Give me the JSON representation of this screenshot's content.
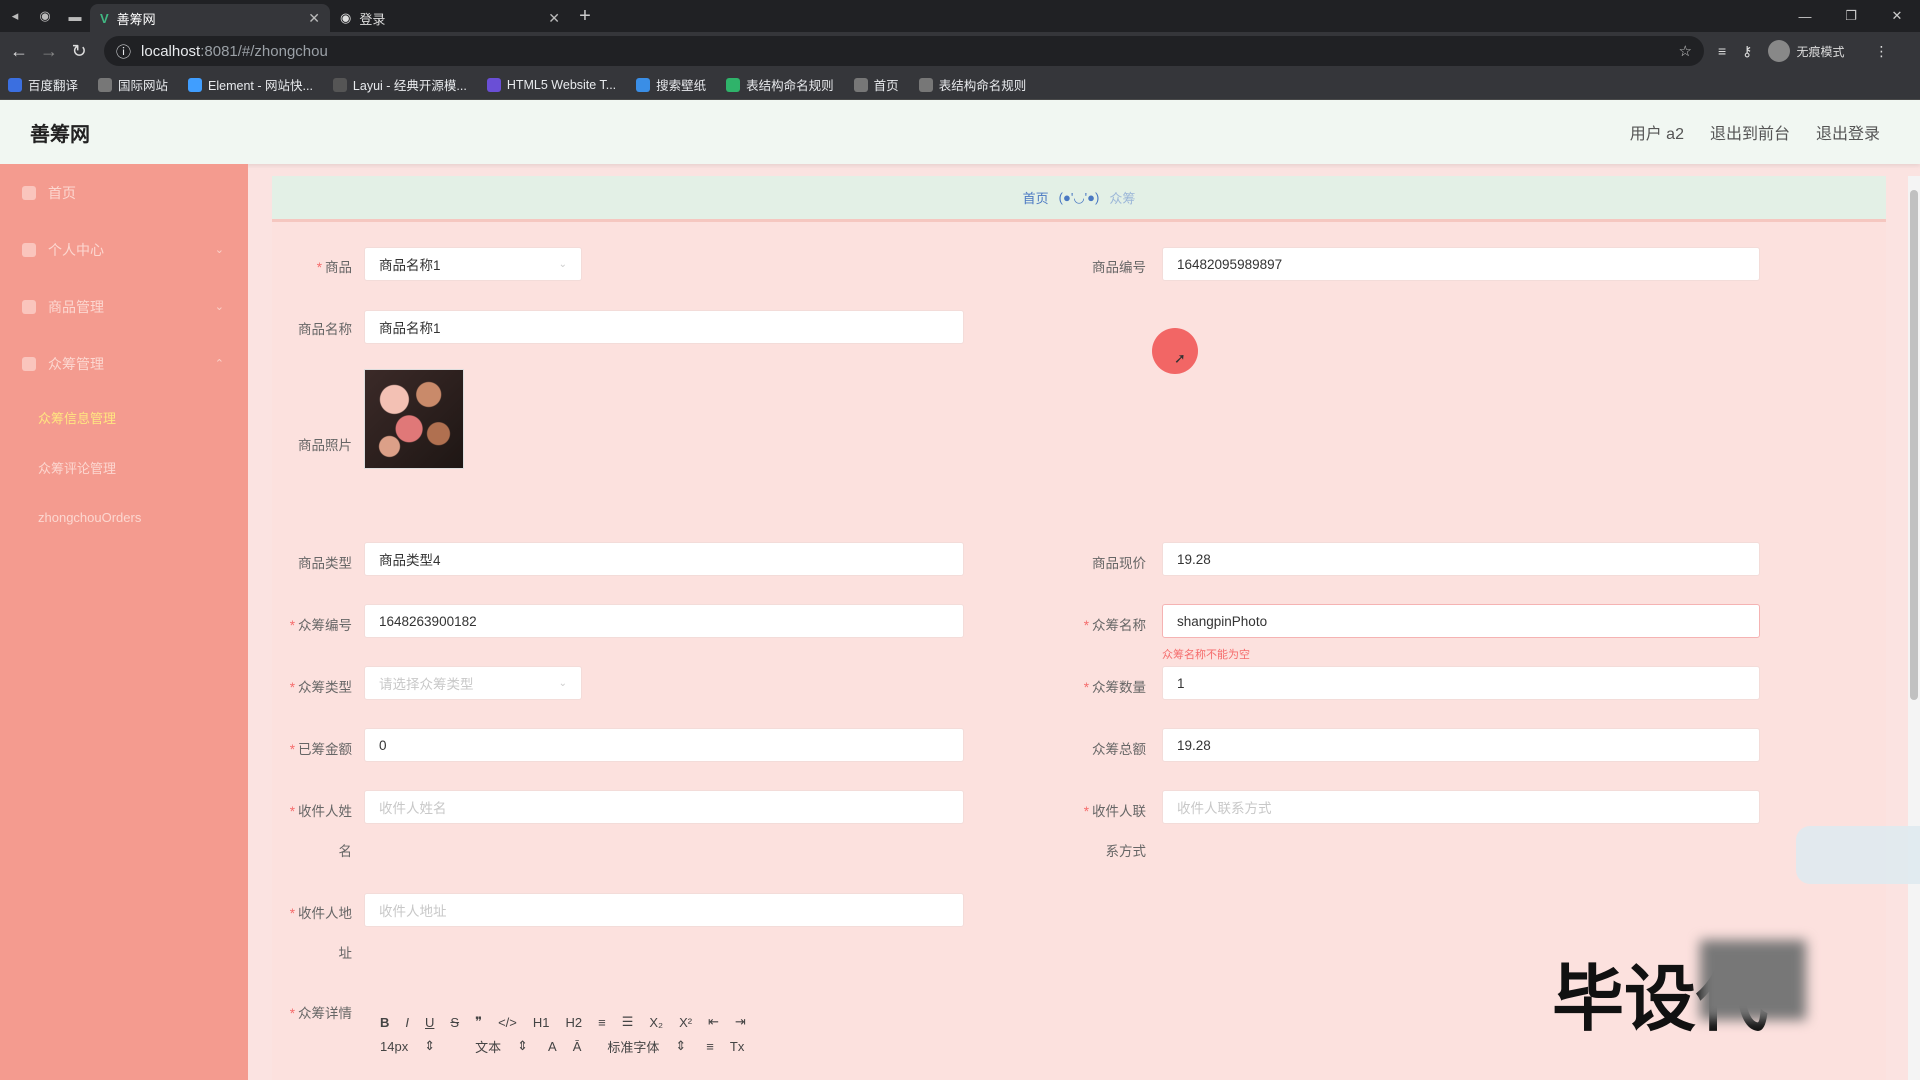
{
  "browser": {
    "tabs": [
      {
        "title": "善筹网",
        "active": true
      },
      {
        "title": "登录",
        "active": false
      }
    ],
    "url_host": "localhost",
    "url_path": ":8081/#/zhongchou",
    "incognito_label": "无痕模式",
    "bookmarks": [
      {
        "label": "百度翻译",
        "color": "#3b6fe0"
      },
      {
        "label": "国际网站",
        "color": "#777777"
      },
      {
        "label": "Element - 网站快...",
        "color": "#409eff"
      },
      {
        "label": "Layui - 经典开源模...",
        "color": "#555555"
      },
      {
        "label": "HTML5 Website T...",
        "color": "#6a4fd6"
      },
      {
        "label": "搜索壁纸",
        "color": "#3a8ee6"
      },
      {
        "label": "表结构命名规则",
        "color": "#2fb36a"
      },
      {
        "label": "首页",
        "color": "#777777"
      },
      {
        "label": "表结构命名规则",
        "color": "#777777"
      }
    ]
  },
  "header": {
    "brand": "善筹网",
    "user": "用户 a2",
    "back_front": "退出到前台",
    "logout": "退出登录"
  },
  "sidebar": {
    "items": [
      {
        "label": "首页",
        "arrow": ""
      },
      {
        "label": "个人中心",
        "arrow": "⌄"
      },
      {
        "label": "商品管理",
        "arrow": "⌄"
      },
      {
        "label": "众筹管理",
        "arrow": "⌃"
      }
    ],
    "subitems": [
      {
        "label": "众筹信息管理",
        "active": true
      },
      {
        "label": "众筹评论管理",
        "active": false
      },
      {
        "label": "zhongchouOrders",
        "active": false
      }
    ]
  },
  "breadcrumb": {
    "home": "首页",
    "sep": "(●'◡'●)",
    "current": "众筹"
  },
  "form": {
    "shangpin_label": "商品",
    "shangpin_value": "商品名称1",
    "bianhao_label": "商品编号",
    "bianhao_value": "16482095989897",
    "mingcheng_label": "商品名称",
    "mingcheng_value": "商品名称1",
    "zhaopian_label": "商品照片",
    "leixing_label": "商品类型",
    "leixing_value": "商品类型4",
    "xianjia_label": "商品现价",
    "xianjia_value": "19.28",
    "zc_bianhao_label": "众筹编号",
    "zc_bianhao_value": "1648263900182",
    "zc_name_label": "众筹名称",
    "zc_name_value": "shangpinPhoto",
    "zc_name_error": "众筹名称不能为空",
    "zc_type_label": "众筹类型",
    "zc_type_placeholder": "请选择众筹类型",
    "zc_count_label": "众筹数量",
    "zc_count_value": "1",
    "yichou_label": "已筹金额",
    "yichou_value": "0",
    "zonge_label": "众筹总额",
    "zonge_value": "19.28",
    "sjr_name_label_a": "收件人姓",
    "sjr_name_label_b": "名",
    "sjr_name_placeholder": "收件人姓名",
    "sjr_phone_label_a": "收件人联",
    "sjr_phone_label_b": "系方式",
    "sjr_phone_placeholder": "收件人联系方式",
    "sjr_addr_label_a": "收件人地",
    "sjr_addr_label_b": "址",
    "sjr_addr_placeholder": "收件人地址",
    "xiangqing_label": "众筹详情"
  },
  "editor": {
    "row1": [
      "B",
      "I",
      "U",
      "S",
      "❞",
      "</>",
      "H1",
      "H2",
      "≡",
      "☰",
      "X₂",
      "X²",
      "⇤",
      "⇥"
    ],
    "font_size": "14px",
    "text_type": "文本",
    "font_family": "标准字体"
  },
  "watermark": "毕设代"
}
